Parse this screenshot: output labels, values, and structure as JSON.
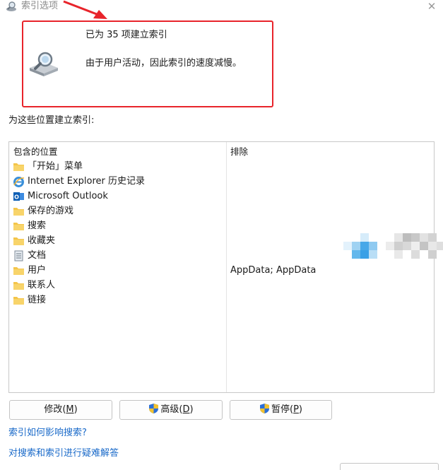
{
  "window": {
    "title": "索引选项",
    "close_glyph": "✕"
  },
  "status": {
    "count_text": "已为 35 项建立索引",
    "message": "由于用户活动，因此索引的速度减慢。",
    "icon": "indexing-drive-icon",
    "highlight_color": "#e8242b"
  },
  "index_label": "为这些位置建立索引:",
  "locations": {
    "include_header": "包含的位置",
    "exclude_header": "排除",
    "items": [
      {
        "label": "「开始」菜单",
        "icon": "folder-icon"
      },
      {
        "label": "Internet Explorer 历史记录",
        "icon": "internet-explorer-icon"
      },
      {
        "label": "Microsoft Outlook",
        "icon": "outlook-icon"
      },
      {
        "label": "保存的游戏",
        "icon": "folder-icon"
      },
      {
        "label": "搜索",
        "icon": "folder-icon"
      },
      {
        "label": "收藏夹",
        "icon": "folder-icon"
      },
      {
        "label": "文档",
        "icon": "document-icon"
      },
      {
        "label": "用户",
        "icon": "folder-icon",
        "exclude": "AppData; AppData"
      },
      {
        "label": "联系人",
        "icon": "folder-icon"
      },
      {
        "label": "链接",
        "icon": "folder-icon"
      }
    ]
  },
  "buttons": {
    "modify": {
      "text": "修改(",
      "key": "M",
      "end": ")"
    },
    "advanced": {
      "text": "高级(",
      "key": "D",
      "end": ")"
    },
    "pause": {
      "text": "暂停(",
      "key": "P",
      "end": ")"
    }
  },
  "links": {
    "how_index_affects": "索引如何影响搜索?",
    "troubleshoot": "对搜索和索引进行疑难解答"
  },
  "colors": {
    "link": "#1a6ac9",
    "folder": "#f4c54a",
    "accent_blue": "#2b88d8"
  }
}
